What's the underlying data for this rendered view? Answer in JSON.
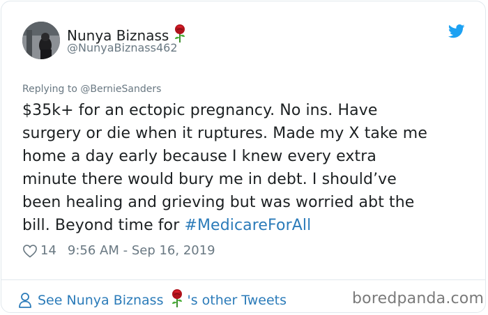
{
  "author": {
    "display_name": "Nunya Biznass",
    "handle": "@NunyaBiznass462"
  },
  "replying_to": "Replying to @BernieSanders",
  "tweet": {
    "text_lines": [
      "$35k+ for an ectopic pregnancy.  No ins. Have",
      "surgery or die when it ruptures.  Made my X take me",
      "home a day early because I knew every extra",
      "minute there would bury me in debt.   I should’ve",
      "been healing and grieving but was worried abt the",
      "bill. Beyond time for "
    ],
    "hashtag": "#MedicareForAll"
  },
  "meta": {
    "likes": "14",
    "timestamp": "9:56 AM - Sep 16, 2019"
  },
  "footer": {
    "see_prefix": "See Nunya Biznass",
    "see_suffix": "'s other Tweets",
    "brand": "boredpanda.com"
  },
  "colors": {
    "link": "#2b7bb9",
    "secondary": "#697882",
    "rose": "#b0121b",
    "border": "#e1e8ed"
  },
  "icons": [
    "twitter-bird-icon",
    "rose-emoji-icon",
    "heart-icon",
    "person-icon"
  ]
}
